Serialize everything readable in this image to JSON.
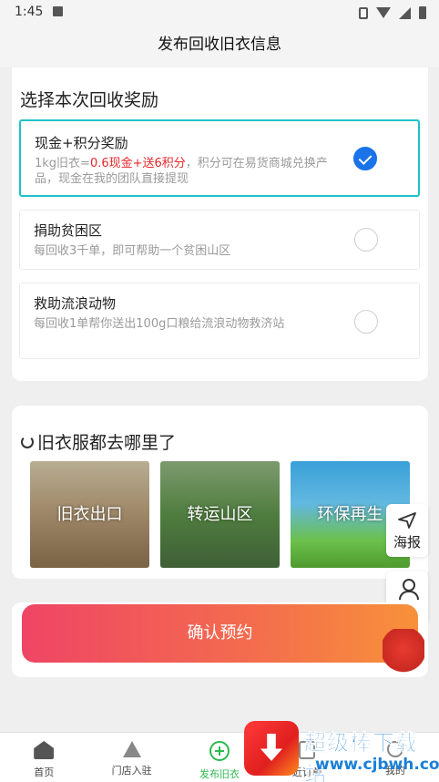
{
  "status_bar": {
    "time": "1:45"
  },
  "header": {
    "title": "发布回收旧衣信息"
  },
  "reward": {
    "section_title": "选择本次回收奖励",
    "options": [
      {
        "title": "现金+积分奖励",
        "desc_prefix": "1kg旧衣=",
        "desc_highlight": "0.6现金+送6积分",
        "desc_suffix": "，积分可在易货商城兑换产品，现金在我的团队直接提现",
        "selected": true
      },
      {
        "title": "捐助贫困区",
        "desc": "每回收3千单，即可帮助一个贫困山区",
        "selected": false
      },
      {
        "title": "救助流浪动物",
        "desc": "每回收1单帮你送出100g口粮给流浪动物救济站",
        "selected": false
      }
    ]
  },
  "destinations": {
    "section_title": "旧衣服都去哪里了",
    "tiles": [
      {
        "label": "旧衣出口"
      },
      {
        "label": "转运山区"
      },
      {
        "label": "环保再生"
      }
    ]
  },
  "float_buttons": {
    "poster": "海报",
    "service": "客服"
  },
  "confirm_button": "确认预约",
  "tabbar": {
    "items": [
      {
        "label": "首页",
        "icon": "home-icon"
      },
      {
        "label": "门店入驻",
        "icon": "store-icon"
      },
      {
        "label": "发布旧衣",
        "icon": "plus-circle-icon",
        "active": true
      },
      {
        "label": "近订单",
        "icon": "order-icon"
      },
      {
        "label": "我的",
        "icon": "user-icon"
      }
    ]
  },
  "watermark": {
    "name": "超级棒下载站",
    "url": "www.cjbwh.com"
  },
  "colors": {
    "accent": "#1fc2c9",
    "radio_on": "#1a73e8",
    "highlight": "#e8262a",
    "tab_active": "#2db94d",
    "button_start": "#ef4565",
    "button_end": "#f8913a"
  }
}
